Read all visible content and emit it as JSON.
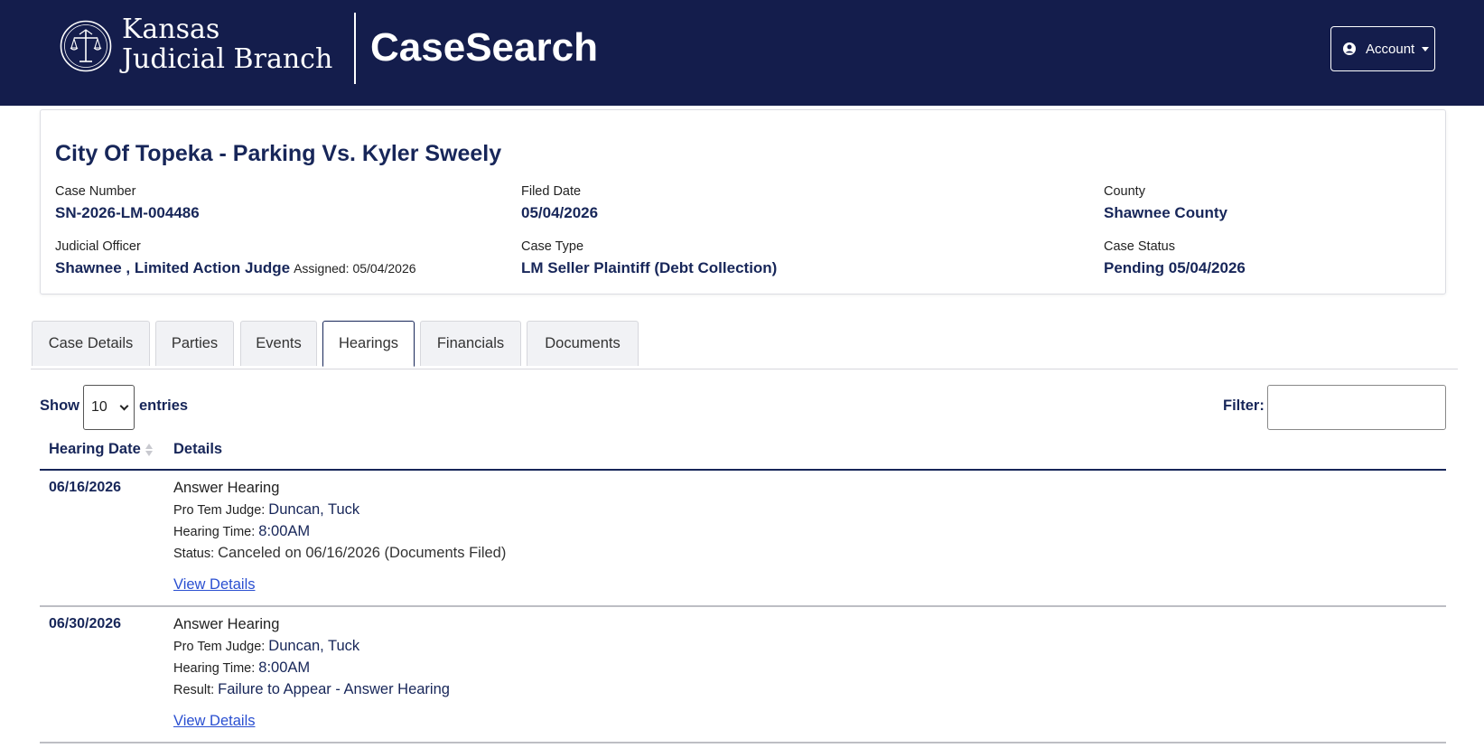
{
  "header": {
    "brand_line1": "Kansas",
    "brand_line2": "Judicial Branch",
    "app_title": "CaseSearch",
    "account_label": "Account",
    "logo_icon": "kansas-judicial-seal-icon",
    "background_color": "#141d4c"
  },
  "case": {
    "title": "City Of Topeka - Parking Vs. Kyler Sweely",
    "case_number_label": "Case Number",
    "case_number": "SN-2026-LM-004486",
    "filed_date_label": "Filed Date",
    "filed_date": "05/04/2026",
    "county_label": "County",
    "county": "Shawnee County",
    "judicial_officer_label": "Judicial Officer",
    "judicial_officer": "Shawnee , Limited Action Judge",
    "assigned": "Assigned: 05/04/2026",
    "case_type_label": "Case Type",
    "case_type": "LM Seller Plaintiff (Debt Collection)",
    "case_status_label": "Case Status",
    "case_status": "Pending 05/04/2026"
  },
  "tabs": [
    {
      "label": "Case Details",
      "active": false
    },
    {
      "label": "Parties",
      "active": false
    },
    {
      "label": "Events",
      "active": false
    },
    {
      "label": "Hearings",
      "active": true
    },
    {
      "label": "Financials",
      "active": false
    },
    {
      "label": "Documents",
      "active": false
    }
  ],
  "controls": {
    "show_label": "Show",
    "entries_value": "10",
    "entries_label": "entries",
    "filter_label": "Filter:",
    "filter_value": ""
  },
  "table": {
    "columns": [
      "Hearing Date",
      "Details"
    ],
    "rows": [
      {
        "date": "06/16/2026",
        "type": "Answer Hearing",
        "judge_label": "Pro Tem Judge:",
        "judge": "Duncan, Tuck",
        "time_label": "Hearing Time:",
        "time": "8:00AM",
        "status_label": "Status:",
        "status": "Canceled on 06/16/2026 (Documents Filed)",
        "link": "View Details"
      },
      {
        "date": "06/30/2026",
        "type": "Answer Hearing",
        "judge_label": "Pro Tem Judge:",
        "judge": "Duncan, Tuck",
        "time_label": "Hearing Time:",
        "time": "8:00AM",
        "status_label": "Result:",
        "status": "Failure to Appear - Answer Hearing",
        "link": "View Details"
      }
    ]
  },
  "colors": {
    "navy": "#172659",
    "link": "#2a4fd1"
  }
}
